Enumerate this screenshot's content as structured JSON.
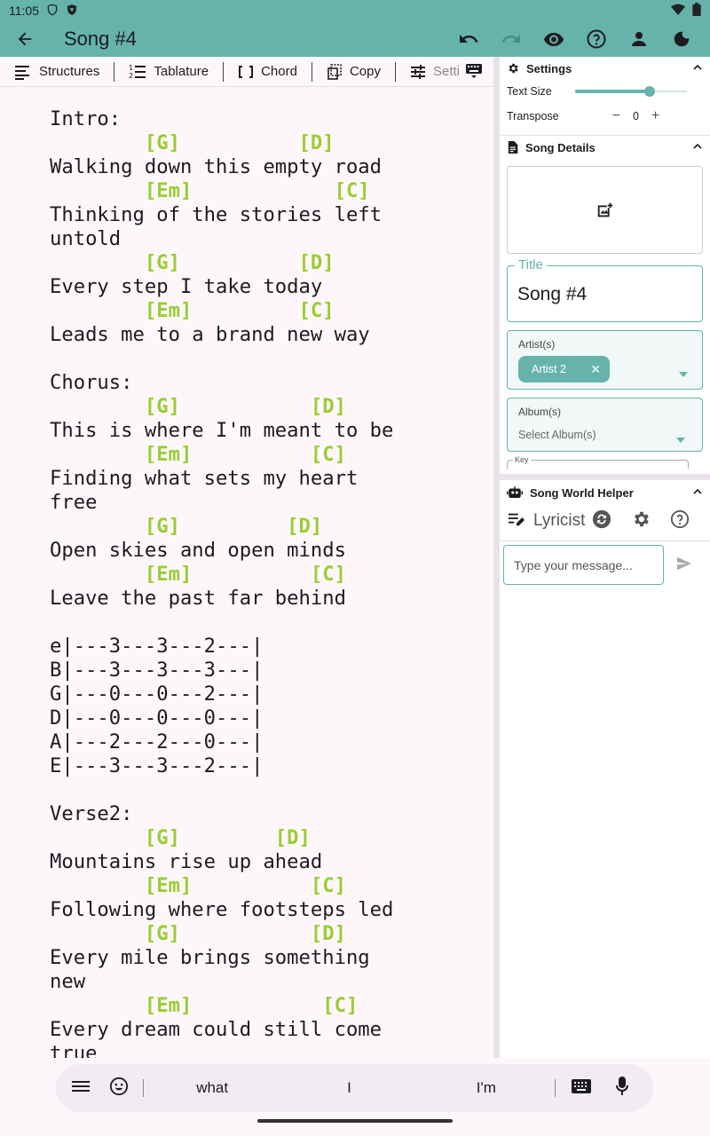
{
  "status_bar": {
    "time": "11:05"
  },
  "app_bar": {
    "title": "Song #4"
  },
  "toolbar": {
    "structures": "Structures",
    "tablature": "Tablature",
    "chord": "Chord",
    "copy": "Copy",
    "settings": "Setti"
  },
  "editor": {
    "lines": [
      {
        "t": "Intro:"
      },
      {
        "c": "        [G]          [D]"
      },
      {
        "t": "Walking down this empty road"
      },
      {
        "c": "        [Em]            [C]"
      },
      {
        "t": "Thinking of the stories left"
      },
      {
        "t": "untold"
      },
      {
        "c": "        [G]          [D]"
      },
      {
        "t": "Every step I take today"
      },
      {
        "c": "        [Em]         [C]"
      },
      {
        "t": "Leads me to a brand new way"
      },
      {
        "t": ""
      },
      {
        "t": "Chorus:"
      },
      {
        "c": "        [G]           [D]"
      },
      {
        "t": "This is where I'm meant to be"
      },
      {
        "c": "        [Em]          [C]"
      },
      {
        "t": "Finding what sets my heart"
      },
      {
        "t": "free"
      },
      {
        "c": "        [G]         [D]"
      },
      {
        "t": "Open skies and open minds"
      },
      {
        "c": "        [Em]          [C]"
      },
      {
        "t": "Leave the past far behind"
      },
      {
        "t": ""
      },
      {
        "t": "e|---3---3---2---|"
      },
      {
        "t": "B|---3---3---3---|"
      },
      {
        "t": "G|---0---0---2---|"
      },
      {
        "t": "D|---0---0---0---|"
      },
      {
        "t": "A|---2---2---0---|"
      },
      {
        "t": "E|---3---3---2---|"
      },
      {
        "t": ""
      },
      {
        "t": "Verse2:"
      },
      {
        "c": "        [G]        [D]"
      },
      {
        "t": "Mountains rise up ahead"
      },
      {
        "c": "        [Em]          [C]"
      },
      {
        "t": "Following where footsteps led"
      },
      {
        "c": "        [G]           [D]"
      },
      {
        "t": "Every mile brings something"
      },
      {
        "t": "new"
      },
      {
        "c": "        [Em]           [C]"
      },
      {
        "t": "Every dream could still come"
      },
      {
        "t": "true"
      }
    ]
  },
  "settings": {
    "header": "Settings",
    "text_size_label": "Text Size",
    "text_size_level": 0.67,
    "transpose_label": "Transpose",
    "transpose_minus": "−",
    "transpose_value": "0",
    "transpose_plus": "+"
  },
  "song_details": {
    "header": "Song Details",
    "title_label": "Title",
    "title_value": "Song #4",
    "artists_label": "Artist(s)",
    "artist_chip": "Artist 2",
    "albums_label": "Album(s)",
    "albums_placeholder": "Select Album(s)",
    "key_label": "Key"
  },
  "helper": {
    "header": "Song World Helper",
    "mode": "Lyricist",
    "chat_placeholder": "Type your message..."
  },
  "keyboard": {
    "suggestions": [
      "what",
      "I",
      "I'm"
    ]
  },
  "colors": {
    "accent": "#66b3ac",
    "chord": "#9acd32",
    "background": "#fdf7fb"
  }
}
